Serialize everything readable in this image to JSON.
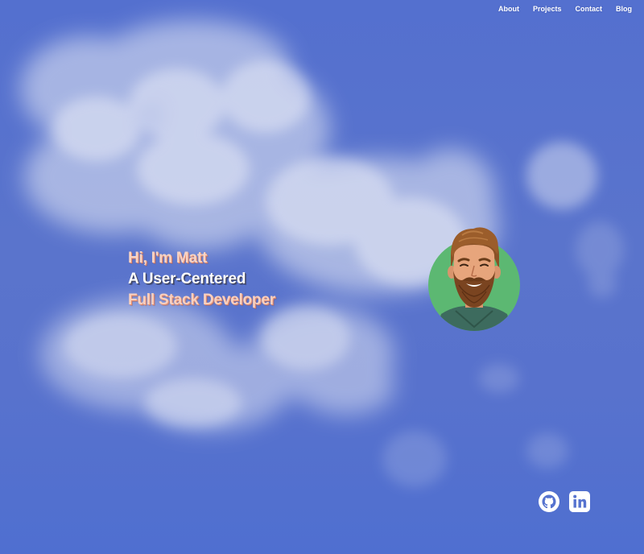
{
  "nav": {
    "items": [
      {
        "label": "About"
      },
      {
        "label": "Projects"
      },
      {
        "label": "Contact"
      },
      {
        "label": "Blog"
      }
    ]
  },
  "hero": {
    "line1": "Hi, I'm Matt",
    "line2": "A User-Centered",
    "line3": "Full Stack Developer"
  },
  "avatar": {
    "icon": "bearded-man-avatar",
    "background_color": "#5cb872"
  },
  "social": [
    {
      "icon": "github-icon"
    },
    {
      "icon": "linkedin-icon"
    }
  ],
  "colors": {
    "sky": "#5470cf",
    "cloud": "#ffffff",
    "accent": "#e78c6b"
  }
}
